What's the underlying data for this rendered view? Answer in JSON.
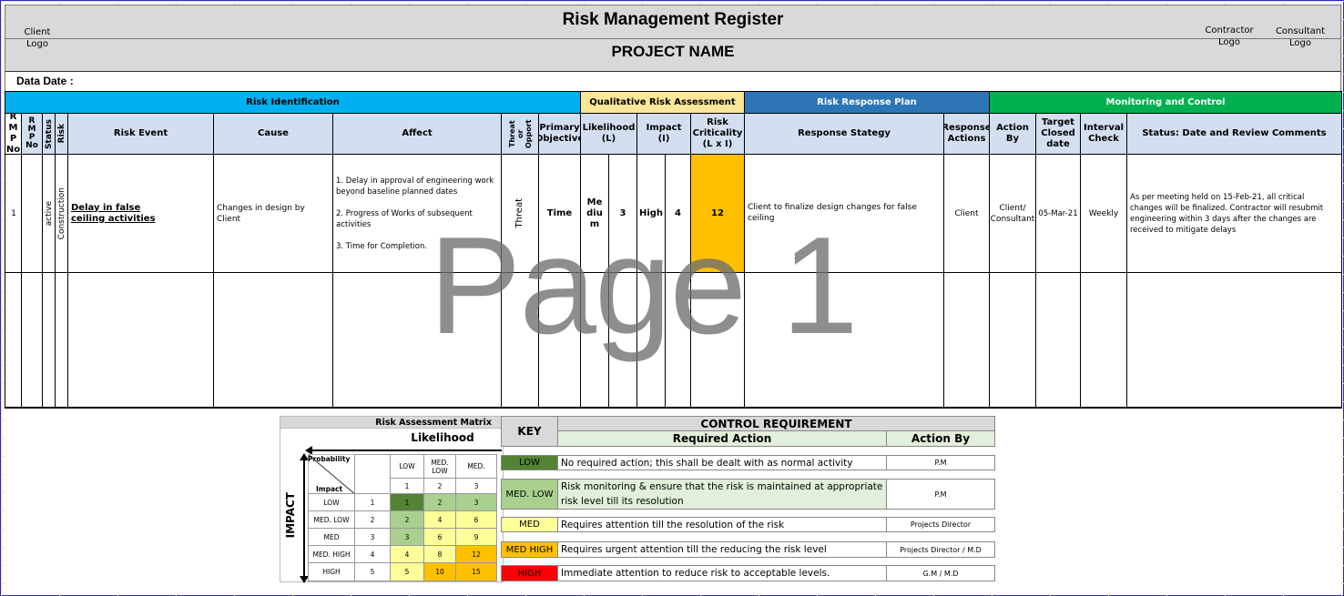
{
  "title": "Risk Management Register",
  "project": "PROJECT NAME",
  "client_logo": "Client\nLogo",
  "contractor_logo": "Contractor\nLogo",
  "consultant_logo": "Consultant\nLogo",
  "data_date_label": "Data Date :",
  "sections": {
    "identification": "Risk Identification",
    "qualitative": "Qualitative Risk Assessment",
    "response": "Risk Response Plan",
    "monitoring": "Monitoring and Control"
  },
  "colors": {
    "identification": "#00b0f0",
    "qualitative": "#ffe699",
    "response": "#2e75b6",
    "monitoring": "#00b050",
    "header": "#d3dff0",
    "criticality": "#ffc000"
  },
  "columns": {
    "rmp": "R M P No",
    "status": "Status",
    "risk": "Risk",
    "event": "Risk Event",
    "cause": "Cause",
    "affect": "Affect",
    "threat": "Threat or Opport",
    "objective": "Primary Objective",
    "likelihood": "Likelihood (L)",
    "impact": "Impact (I)",
    "criticality": "Risk Criticality (L x I)",
    "strategy": "Response Stategy",
    "resp_actions": "Response Actions",
    "action_by": "Action By",
    "target": "Target Closed date",
    "interval": "Interval Check",
    "status_comments": "Status: Date and Review Comments"
  },
  "row": {
    "no": "1",
    "status": "active",
    "risk": "Construction",
    "event": "Delay in false ceiling activities",
    "cause": "Changes in design by Client",
    "affect_1": "1. Delay in approval of engineering work beyond baseline planned dates",
    "affect_2": "2. Progress of Works of subsequent activities",
    "affect_3": "3. Time for Completion.",
    "threat": "Threat",
    "objective": "Time",
    "likelihood": "Medium",
    "l_val": "3",
    "impact": "High",
    "i_val": "4",
    "criticality": "12",
    "strategy": "Client to finalize design changes for false ceiling",
    "resp_actions": "Client",
    "action_by": "Client/ Consultant",
    "target": "05-Mar-21",
    "interval": "Weekly",
    "comments": "As per meeting held on 15-Feb-21, all critical changes will be finalized. Contractor will resubmit engineering within 3 days after the changes are received to mitigate delays"
  },
  "watermark": "Page 1",
  "matrix": {
    "title": "Risk Assessment Matrix",
    "likelihood": "Likelihood",
    "impact_axis": "IMPACT",
    "probability": "Probability",
    "impact": "Impact",
    "cols": [
      "LOW",
      "MED. LOW",
      "MED."
    ],
    "col_nums": [
      "1",
      "2",
      "3"
    ],
    "rows": [
      {
        "label": "LOW",
        "n": "1",
        "v": [
          "1",
          "2",
          "3"
        ]
      },
      {
        "label": "MED. LOW",
        "n": "2",
        "v": [
          "2",
          "4",
          "6"
        ]
      },
      {
        "label": "MED",
        "n": "3",
        "v": [
          "3",
          "6",
          "9"
        ]
      },
      {
        "label": "MED. HIGH",
        "n": "4",
        "v": [
          "4",
          "8",
          "12"
        ]
      },
      {
        "label": "HIGH",
        "n": "5",
        "v": [
          "5",
          "10",
          "15"
        ]
      }
    ]
  },
  "key": {
    "key_label": "KEY",
    "control": "CONTROL REQUIREMENT",
    "required": "Required Action",
    "action_by": "Action By",
    "rows": [
      {
        "level": "LOW",
        "action": "No required action; this shall be dealt with as normal activity",
        "by": "P.M",
        "color": "#548235"
      },
      {
        "level": "MED. LOW",
        "action": "Risk monitoring & ensure that the risk is maintained at appropriate risk level till its resolution",
        "by": "P.M",
        "color": "#a9d08e"
      },
      {
        "level": "MED",
        "action": "Requires attention till the resolution of the risk",
        "by": "Projects Director",
        "color": "#ffff99"
      },
      {
        "level": "MED HIGH",
        "action": "Requires urgent attention till the reducing the risk level",
        "by": "Projects Director / M.D",
        "color": "#ffc000"
      },
      {
        "level": "HIGH",
        "action": "Immediate attention to reduce risk to acceptable levels.",
        "by": "G.M / M.D",
        "color": "#ff0000"
      }
    ]
  }
}
